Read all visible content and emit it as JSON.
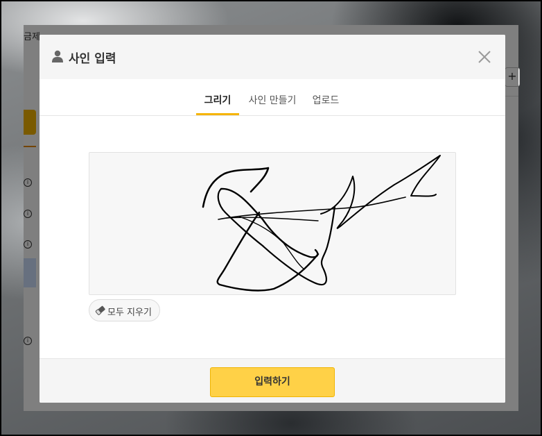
{
  "background_page": {
    "notice_text_start": "금제",
    "notice_link_text": "",
    "notice_text_end": "",
    "plus_label": "+",
    "row_icon_label": "i"
  },
  "modal": {
    "title": "사인 입력",
    "title_icon": "user-icon",
    "close_icon": "close-icon",
    "tabs": [
      {
        "label": "그리기",
        "active": true
      },
      {
        "label": "사인 만들기",
        "active": false
      },
      {
        "label": "업로드",
        "active": false
      }
    ],
    "signature_canvas": {
      "has_drawing": true,
      "stroke_color": "#000000"
    },
    "clear_button": {
      "label": "모두 지우기",
      "icon": "eraser-icon"
    },
    "submit_button": {
      "label": "입력하기"
    }
  },
  "colors": {
    "accent": "#ffd147",
    "tab_active_underline": "#f6b400",
    "overlay": "rgba(0,0,0,0.5)"
  }
}
